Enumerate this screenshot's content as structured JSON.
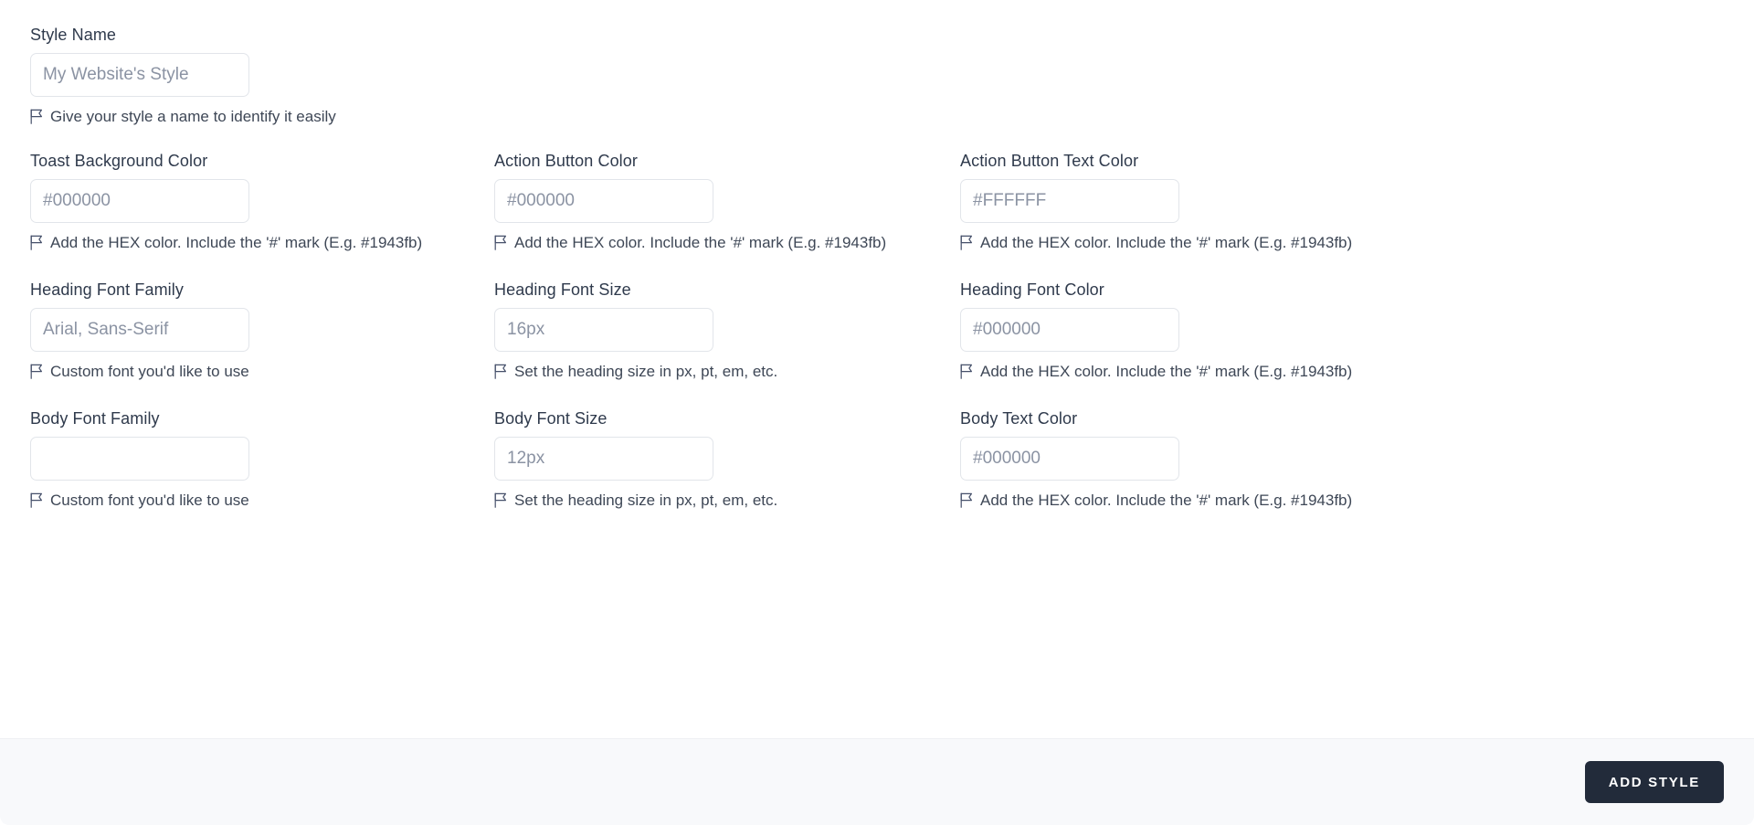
{
  "form": {
    "rows": [
      {
        "fields": [
          {
            "label": "Style Name",
            "value": "",
            "placeholder": "My Website's Style",
            "helper": "Give your style a name to identify it easily",
            "name": "style-name"
          }
        ]
      },
      {
        "fields": [
          {
            "label": "Toast Background Color",
            "value": "",
            "placeholder": "#000000",
            "helper": "Add the HEX color. Include the '#' mark (E.g. #1943fb)",
            "name": "toast-background-color"
          },
          {
            "label": "Action Button Color",
            "value": "",
            "placeholder": "#000000",
            "helper": "Add the HEX color. Include the '#' mark (E.g. #1943fb)",
            "name": "action-button-color"
          },
          {
            "label": "Action Button Text Color",
            "value": "",
            "placeholder": "#FFFFFF",
            "helper": "Add the HEX color. Include the '#' mark (E.g. #1943fb)",
            "name": "action-button-text-color"
          }
        ]
      },
      {
        "fields": [
          {
            "label": "Heading Font Family",
            "value": "",
            "placeholder": "Arial, Sans-Serif",
            "helper": "Custom font you'd like to use",
            "name": "heading-font-family"
          },
          {
            "label": "Heading Font Size",
            "value": "",
            "placeholder": "16px",
            "helper": "Set the heading size in px, pt, em, etc.",
            "name": "heading-font-size"
          },
          {
            "label": "Heading Font Color",
            "value": "",
            "placeholder": "#000000",
            "helper": "Add the HEX color. Include the '#' mark (E.g. #1943fb)",
            "name": "heading-font-color"
          }
        ]
      },
      {
        "fields": [
          {
            "label": "Body Font Family",
            "value": "",
            "placeholder": "",
            "helper": "Custom font you'd like to use",
            "name": "body-font-family"
          },
          {
            "label": "Body Font Size",
            "value": "",
            "placeholder": "12px",
            "helper": "Set the heading size in px, pt, em, etc.",
            "name": "body-font-size"
          },
          {
            "label": "Body Text Color",
            "value": "",
            "placeholder": "#000000",
            "helper": "Add the HEX color. Include the '#' mark (E.g. #1943fb)",
            "name": "body-text-color"
          }
        ]
      }
    ]
  },
  "footer": {
    "submit_label": "Add Style"
  },
  "icons": {
    "helper": "flag-icon"
  },
  "colors": {
    "button_bg": "#222b3a",
    "button_text": "#ffffff",
    "footer_bg": "#f8f9fb",
    "input_border": "#e2e5ea",
    "label_text": "#2f3a4c",
    "placeholder_text": "#8b93a3"
  }
}
